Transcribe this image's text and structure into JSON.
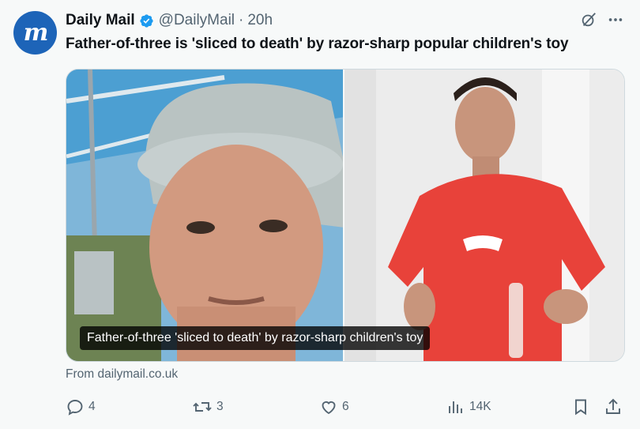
{
  "tweet": {
    "display_name": "Daily Mail",
    "handle": "@DailyMail",
    "separator": "·",
    "time": "20h",
    "avatar_letter": "m",
    "text": "Father-of-three is 'sliced to death' by razor-sharp popular children's toy",
    "media_caption": "Father-of-three 'sliced to death' by razor-sharp children's toy",
    "source": "From dailymail.co.uk"
  },
  "actions": {
    "replies": "4",
    "reposts": "3",
    "likes": "6",
    "views": "14K"
  },
  "colors": {
    "avatar_bg": "#1d64b8",
    "verified": "#1d9bf0",
    "muted_text": "#536471",
    "background": "#f7f9f9"
  },
  "icons": {
    "verified": "verified-badge-icon",
    "grok": "grok-icon",
    "more": "more-icon",
    "reply": "reply-icon",
    "repost": "repost-icon",
    "like": "heart-icon",
    "views": "views-icon",
    "bookmark": "bookmark-icon",
    "share": "share-icon"
  }
}
